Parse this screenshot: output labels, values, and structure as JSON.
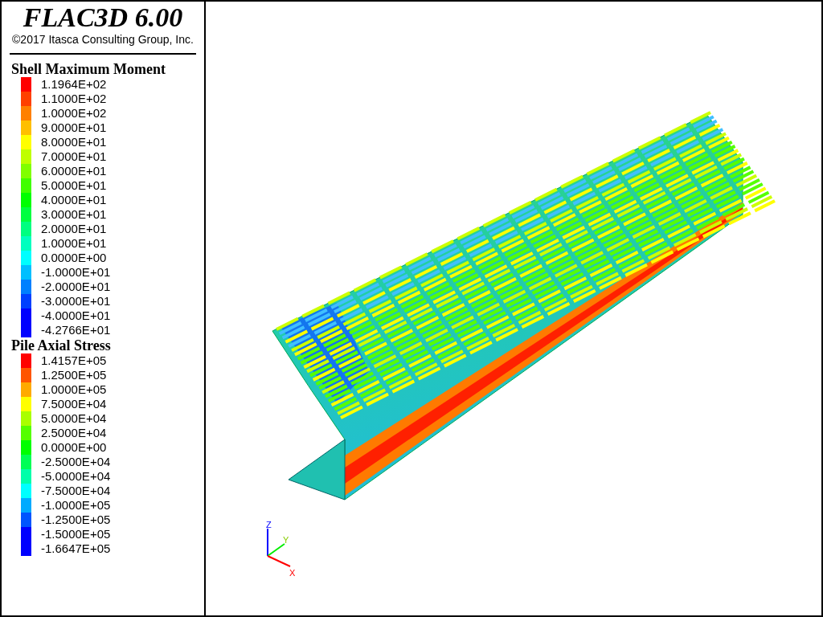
{
  "header": {
    "title": "FLAC3D 6.00",
    "copyright": "©2017 Itasca Consulting Group, Inc."
  },
  "legends": [
    {
      "title": "Shell Maximum Moment",
      "entries": [
        {
          "label": "1.1964E+02",
          "color": "#ff0000"
        },
        {
          "label": "1.1000E+02",
          "color": "#ff4000"
        },
        {
          "label": "1.0000E+02",
          "color": "#ff8000"
        },
        {
          "label": "9.0000E+01",
          "color": "#ffbf00"
        },
        {
          "label": "8.0000E+01",
          "color": "#ffff00"
        },
        {
          "label": "7.0000E+01",
          "color": "#bfff00"
        },
        {
          "label": "6.0000E+01",
          "color": "#80ff00"
        },
        {
          "label": "5.0000E+01",
          "color": "#40ff00"
        },
        {
          "label": "4.0000E+01",
          "color": "#00ff00"
        },
        {
          "label": "3.0000E+01",
          "color": "#00ff40"
        },
        {
          "label": "2.0000E+01",
          "color": "#00ff80"
        },
        {
          "label": "1.0000E+01",
          "color": "#00ffbf"
        },
        {
          "label": "0.0000E+00",
          "color": "#00ffff"
        },
        {
          "label": "-1.0000E+01",
          "color": "#00bfff"
        },
        {
          "label": "-2.0000E+01",
          "color": "#0080ff"
        },
        {
          "label": "-3.0000E+01",
          "color": "#0040ff"
        },
        {
          "label": "-4.0000E+01",
          "color": "#0000ff"
        },
        {
          "label": "-4.2766E+01",
          "color": "#0000ff"
        }
      ]
    },
    {
      "title": "Pile Axial Stress",
      "entries": [
        {
          "label": "1.4157E+05",
          "color": "#ff0000"
        },
        {
          "label": "1.2500E+05",
          "color": "#ff5500"
        },
        {
          "label": "1.0000E+05",
          "color": "#ffaa00"
        },
        {
          "label": "7.5000E+04",
          "color": "#ffff00"
        },
        {
          "label": "5.0000E+04",
          "color": "#aaff00"
        },
        {
          "label": "2.5000E+04",
          "color": "#55ff00"
        },
        {
          "label": "0.0000E+00",
          "color": "#00ff00"
        },
        {
          "label": "-2.5000E+04",
          "color": "#00ff55"
        },
        {
          "label": "-5.0000E+04",
          "color": "#00ffaa"
        },
        {
          "label": "-7.5000E+04",
          "color": "#00ffff"
        },
        {
          "label": "-1.0000E+05",
          "color": "#00aaff"
        },
        {
          "label": "-1.2500E+05",
          "color": "#0055ff"
        },
        {
          "label": "-1.5000E+05",
          "color": "#0000ff"
        },
        {
          "label": "-1.6647E+05",
          "color": "#0000ff"
        }
      ]
    }
  ],
  "axes": {
    "z": "Z",
    "y": "Y",
    "x": "X"
  }
}
